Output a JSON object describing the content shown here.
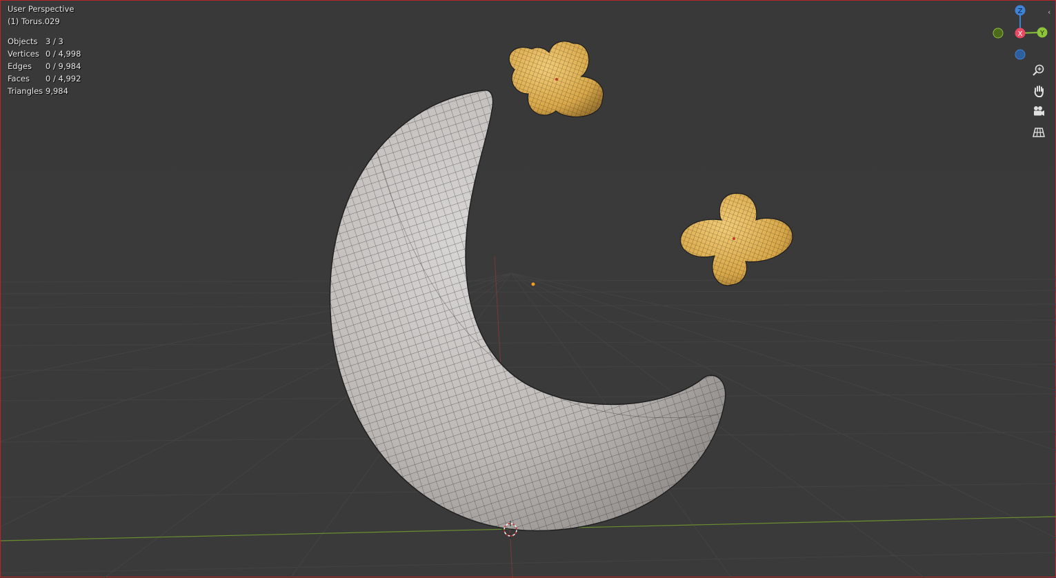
{
  "viewport": {
    "view_name": "User Perspective",
    "active_object": "(1) Torus.029"
  },
  "stats": [
    {
      "label": "Objects",
      "value": "3 / 3"
    },
    {
      "label": "Vertices",
      "value": "0 / 4,998"
    },
    {
      "label": "Edges",
      "value": "0 / 9,984"
    },
    {
      "label": "Faces",
      "value": "0 / 4,992"
    },
    {
      "label": "Triangles",
      "value": "9,984"
    }
  ],
  "gizmo": {
    "z_label": "Z",
    "x_label": "X",
    "y_label": "Y",
    "colors": {
      "x": "#e84a62",
      "y": "#8cc53a",
      "z": "#3d84d8",
      "neg_y": "#6b8e23",
      "neg_z": "#2d5f9e"
    }
  },
  "nav_tools": [
    {
      "name": "zoom",
      "icon": "zoom-icon"
    },
    {
      "name": "pan",
      "icon": "hand-icon"
    },
    {
      "name": "camera",
      "icon": "camera-icon"
    },
    {
      "name": "ortho-toggle",
      "icon": "grid-icon"
    }
  ],
  "colors": {
    "background": "#393939",
    "moon": "#b4b0ae",
    "star": "#d8a84a",
    "border_active": "#b8262a"
  }
}
